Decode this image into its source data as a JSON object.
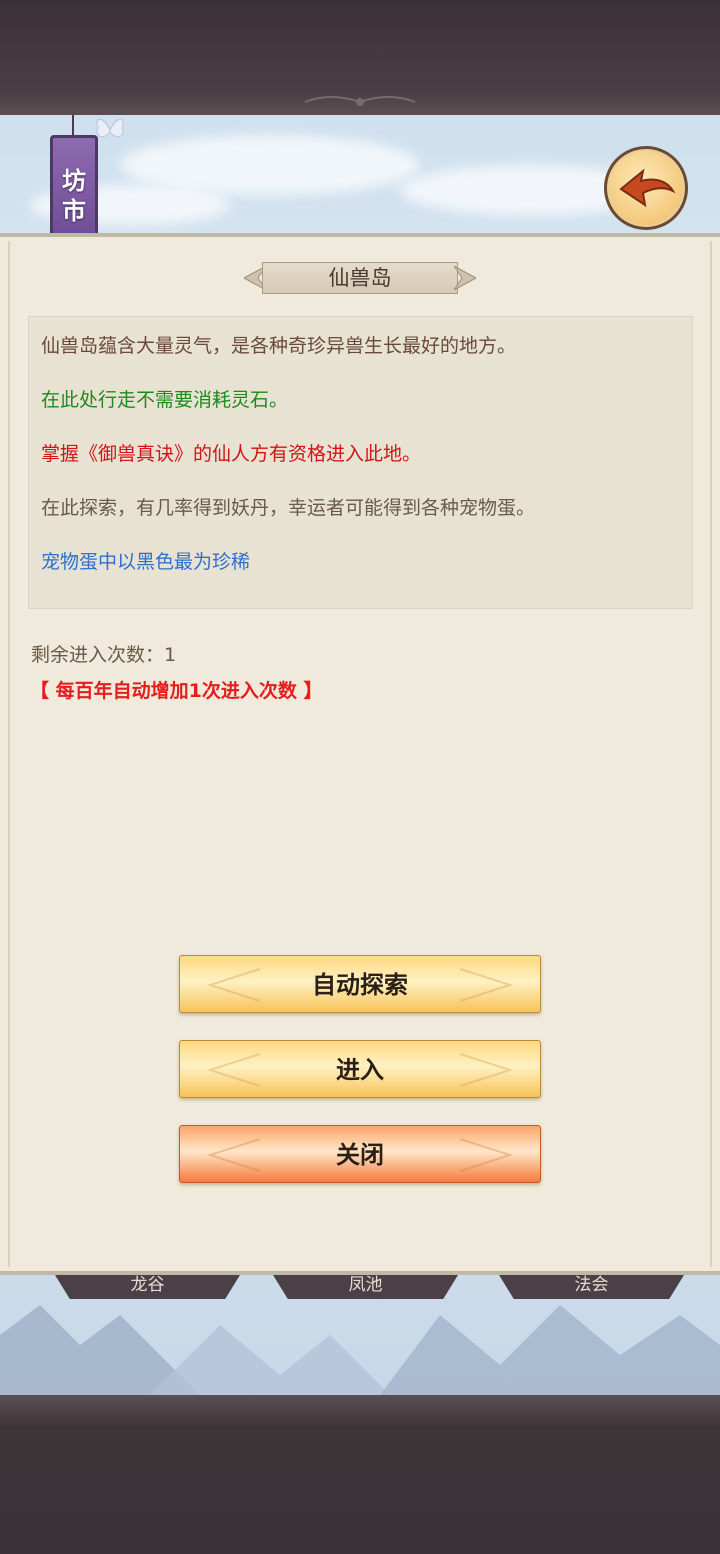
{
  "header": {
    "banner_text": "坊市",
    "back_icon": "back-arrow-icon"
  },
  "dialog": {
    "title": "仙兽岛",
    "description": [
      {
        "text": "仙兽岛蕴含大量灵气，是各种奇珍异兽生长最好的地方。",
        "color": "#6b4a3a"
      },
      {
        "text": "在此处行走不需要消耗灵石。",
        "color": "#1f8a1f"
      },
      {
        "text": "掌握《御兽真诀》的仙人方有资格进入此地。",
        "color": "#d21414"
      },
      {
        "text": "在此探索，有几率得到妖丹，幸运者可能得到各种宠物蛋。",
        "color": "#6b5a4a"
      },
      {
        "text": "宠物蛋中以黑色最为珍稀",
        "color": "#2f6fd0"
      }
    ],
    "remaining_label": "剩余进入次数：1",
    "notice": "【 每百年自动增加1次进入次数 】",
    "buttons": {
      "auto_explore": "自动探索",
      "enter": "进入",
      "close": "关闭"
    }
  },
  "bottom_tabs": [
    "龙谷",
    "凤池",
    "法会"
  ]
}
